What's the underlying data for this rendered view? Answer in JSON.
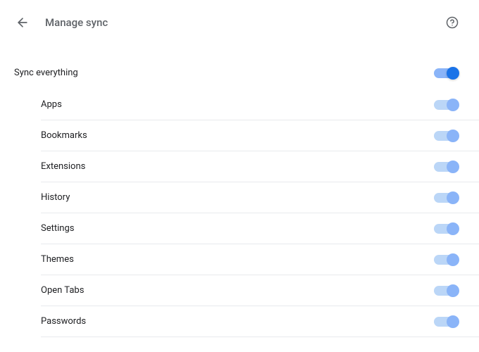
{
  "header": {
    "title": "Manage sync"
  },
  "master": {
    "label": "Sync everything",
    "enabled": true
  },
  "items": [
    {
      "label": "Apps",
      "enabled": true
    },
    {
      "label": "Bookmarks",
      "enabled": true
    },
    {
      "label": "Extensions",
      "enabled": true
    },
    {
      "label": "History",
      "enabled": true
    },
    {
      "label": "Settings",
      "enabled": true
    },
    {
      "label": "Themes",
      "enabled": true
    },
    {
      "label": "Open Tabs",
      "enabled": true
    },
    {
      "label": "Passwords",
      "enabled": true
    }
  ]
}
